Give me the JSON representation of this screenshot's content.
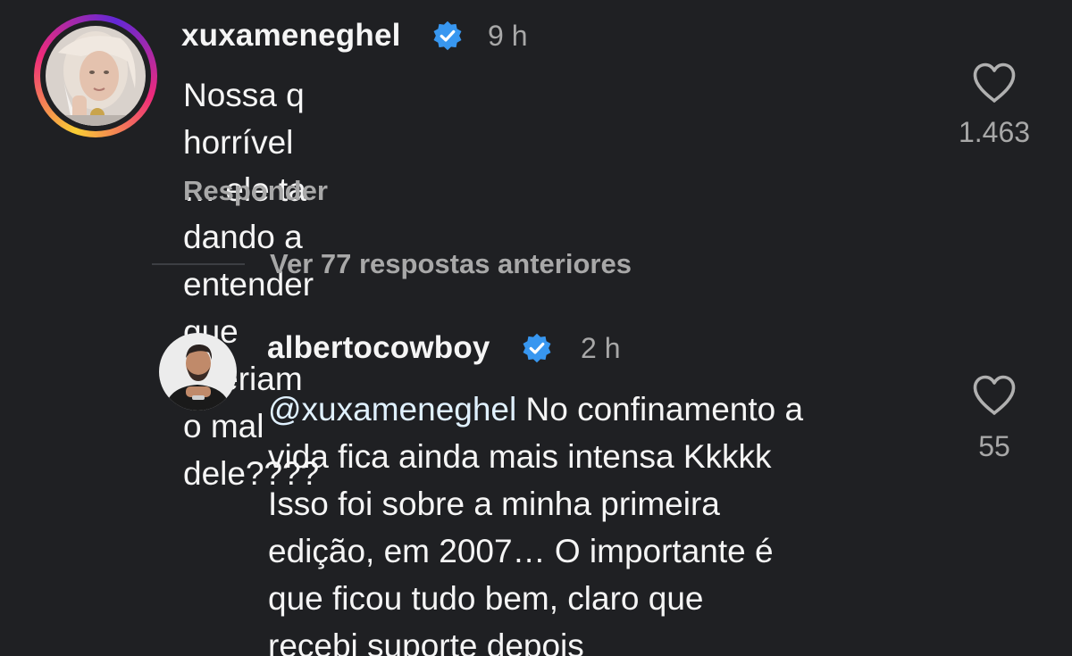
{
  "comments": [
    {
      "username": "xuxameneghel",
      "verified": true,
      "time": "9 h",
      "text": "Nossa q horrível … ele ta dando a\nentender que queriam o mal dele????",
      "reply_label": "Responder",
      "likes": "1.463",
      "avatar_icon": "profile-photo-blonde-woman"
    },
    {
      "username": "albertocowboy",
      "verified": true,
      "time": "2 h",
      "mention": "@xuxameneghel",
      "text": " No confinamento a\nvida fica ainda mais intensa Kkkkk\nIsso foi sobre a minha primeira\nedição, em 2007… O importante é\nque ficou tudo bem, claro que\nrecebi suporte depois",
      "likes": "55",
      "avatar_icon": "profile-photo-man-beard"
    }
  ],
  "view_replies_label": "Ver 77 respostas anteriores",
  "colors": {
    "background": "#1f2023",
    "text": "#f5f5f5",
    "secondary_text": "#a8a8a8",
    "verified_blue": "#3897f0",
    "mention": "#e0f1ff"
  }
}
